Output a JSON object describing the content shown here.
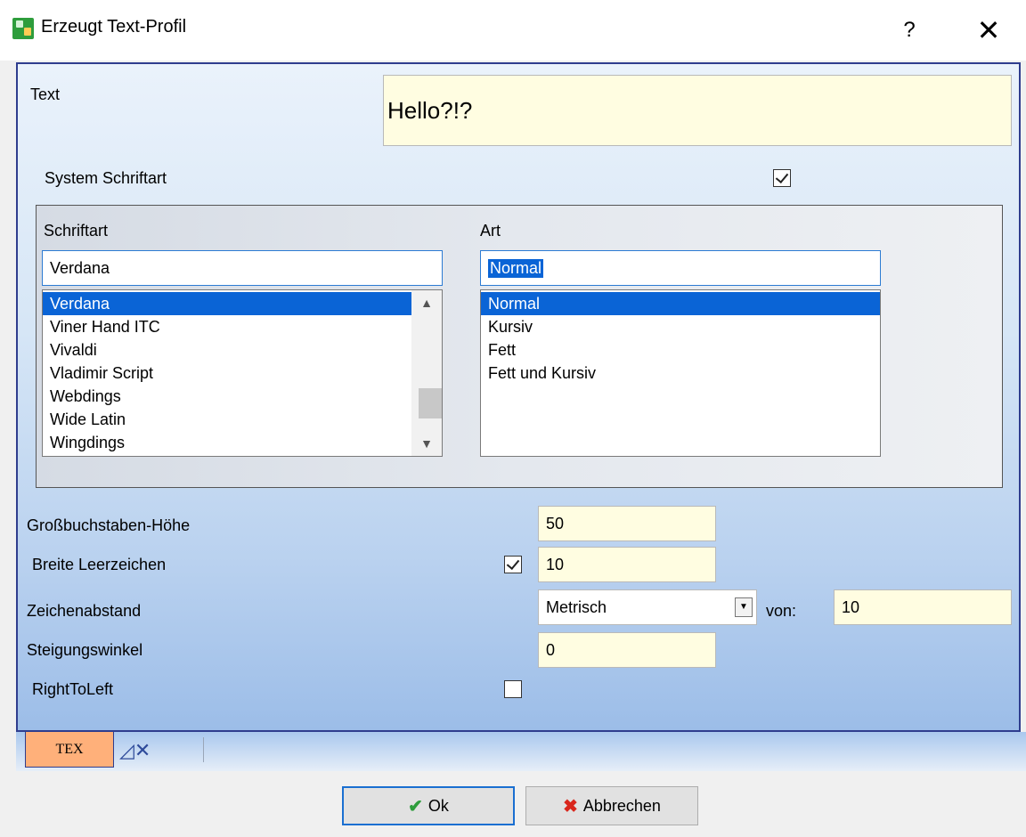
{
  "window": {
    "title": "Erzeugt Text-Profil",
    "help": "?",
    "close": "✕"
  },
  "text": {
    "label": "Text",
    "value": "Hello?!?"
  },
  "system_font": {
    "label": "System Schriftart",
    "checked": true
  },
  "font": {
    "label": "Schriftart",
    "value": "Verdana",
    "items": [
      "Verdana",
      "Viner Hand ITC",
      "Vivaldi",
      "Vladimir Script",
      "Webdings",
      "Wide Latin",
      "Wingdings"
    ],
    "selected": "Verdana"
  },
  "style": {
    "label": "Art",
    "value": "Normal",
    "items": [
      "Normal",
      "Kursiv",
      "Fett",
      "Fett und Kursiv"
    ],
    "selected": "Normal"
  },
  "cap_height": {
    "label": "Großbuchstaben-Höhe",
    "value": "50"
  },
  "space_width": {
    "label": "Breite Leerzeichen",
    "checked": true,
    "value": "10"
  },
  "char_spacing": {
    "label": "Zeichenabstand",
    "mode": "Metrisch",
    "von_label": "von:",
    "value": "10"
  },
  "slant": {
    "label": "Steigungswinkel",
    "value": "0"
  },
  "rtl": {
    "label": "RightToLeft",
    "checked": false
  },
  "tabs": {
    "tex_label": "TEX"
  },
  "buttons": {
    "ok": "Ok",
    "cancel": "Abbrechen"
  }
}
